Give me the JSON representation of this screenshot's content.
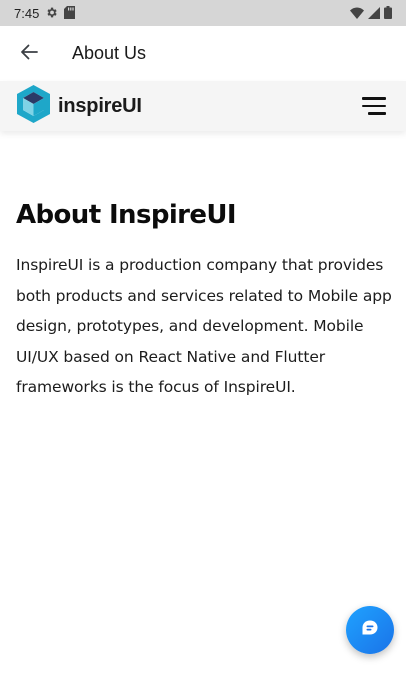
{
  "status_bar": {
    "time": "7:45",
    "left_icons": [
      "gear-icon",
      "sd-card-icon"
    ],
    "right_icons": [
      "wifi-icon",
      "signal-icon",
      "battery-icon"
    ]
  },
  "app_bar": {
    "back_icon": "arrow-left-icon",
    "title": "About Us"
  },
  "site_header": {
    "logo_text": "inspireUI",
    "menu_icon": "hamburger-menu-icon",
    "logo_colors": [
      "#1ea7c9",
      "#2b3a66"
    ]
  },
  "content": {
    "heading": "About InspireUI",
    "paragraph": "InspireUI is a production company that provides both products and services related to Mobile app design, prototypes, and development. Mobile UI/UX based on React Native and Flutter frameworks is the focus of InspireUI."
  },
  "chat_button": {
    "icon": "chat-bubble-icon",
    "color": "#1a8cff"
  }
}
